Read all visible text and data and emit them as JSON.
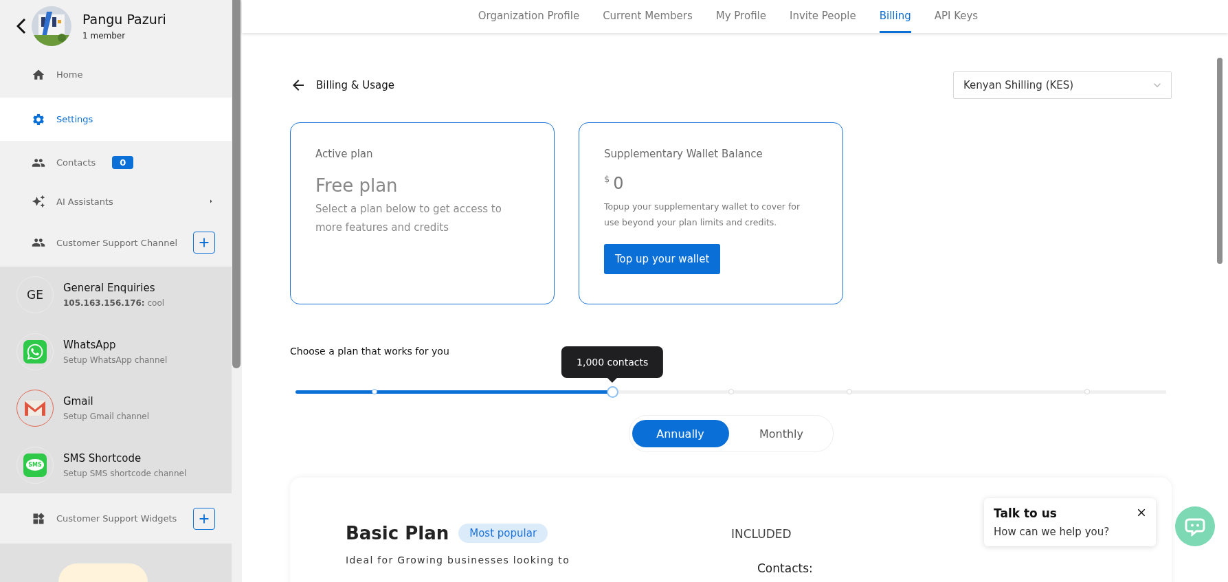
{
  "organization": {
    "name": "Pangu Pazuri",
    "members": "1 member"
  },
  "nav": [
    {
      "kind": "home",
      "label": "Home",
      "selected": false
    },
    {
      "kind": "settings",
      "label": "Settings",
      "selected": true
    },
    {
      "kind": "contacts",
      "label": "Contacts",
      "badge": "0",
      "selected": false
    },
    {
      "kind": "assistants",
      "label": "AI Assistants",
      "selected": false
    },
    {
      "kind": "channel",
      "label": "Customer Support Channel",
      "selected": false
    }
  ],
  "channels": [
    {
      "kind": "initials",
      "initials": "GE",
      "name": "General Enquiries",
      "subtitle": "**105.163.156.176:** cool"
    },
    {
      "kind": "whatsapp",
      "name": "WhatsApp",
      "subtitle": "Setup WhatsApp channel"
    },
    {
      "kind": "gmail",
      "name": "Gmail",
      "subtitle": "Setup Gmail channel"
    },
    {
      "kind": "sms",
      "icon_text": "SMS",
      "name": "SMS Shortcode",
      "subtitle": "Setup SMS shortcode channel"
    }
  ],
  "widgets": {
    "label": "Customer Support Widgets"
  },
  "tabs": [
    {
      "label": "Organization Profile",
      "selected": false
    },
    {
      "label": "Current Members",
      "selected": false
    },
    {
      "label": "My Profile",
      "selected": false
    },
    {
      "label": "Invite People",
      "selected": false
    },
    {
      "label": "Billing",
      "selected": true
    },
    {
      "label": "API Keys",
      "selected": false
    }
  ],
  "page": {
    "title": "Billing & Usage",
    "currency": "Kenyan Shilling (KES)"
  },
  "active_plan": {
    "label": "Active plan",
    "name": "Free plan",
    "description": "Select a plan below to get access to more features and credits"
  },
  "wallet": {
    "label": "Supplementary Wallet Balance",
    "currency_symbol": "$",
    "amount": "0",
    "description": "Topup your supplementary wallet to cover for use beyond your plan limits and credits.",
    "button": "Top up your wallet"
  },
  "plan_picker": {
    "heading": "Choose a plan that works for you",
    "slider": {
      "level": 0.364,
      "tooltip": "1,000 contacts"
    },
    "billing_periods": [
      {
        "label": "Annually",
        "selected": true
      },
      {
        "label": "Monthly",
        "selected": false
      }
    ]
  },
  "plan": {
    "name": "Basic Plan",
    "badge": "Most popular",
    "description": "Ideal for Growing businesses looking to",
    "included_heading": "INCLUDED",
    "features": [
      "Contacts:"
    ]
  },
  "chat_prompt": {
    "title": "Talk to us",
    "message": "How can we help you?"
  }
}
